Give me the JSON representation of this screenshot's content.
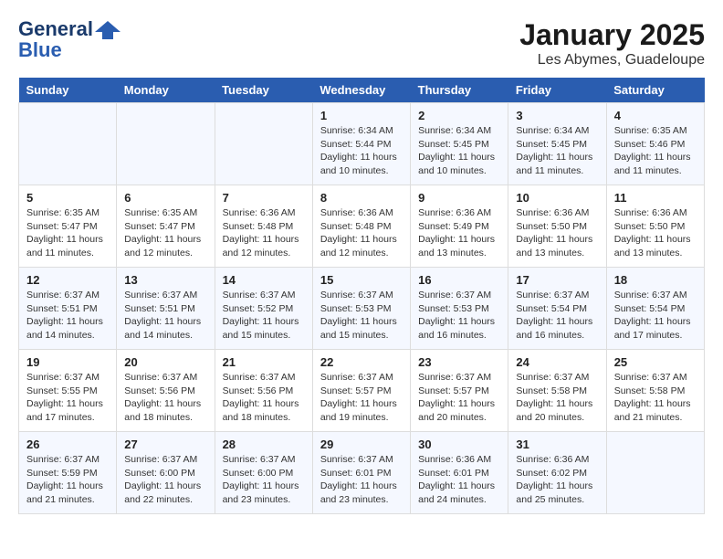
{
  "header": {
    "logo_line1": "General",
    "logo_line2": "Blue",
    "month_year": "January 2025",
    "location": "Les Abymes, Guadeloupe"
  },
  "weekdays": [
    "Sunday",
    "Monday",
    "Tuesday",
    "Wednesday",
    "Thursday",
    "Friday",
    "Saturday"
  ],
  "weeks": [
    [
      {
        "day": "",
        "info": ""
      },
      {
        "day": "",
        "info": ""
      },
      {
        "day": "",
        "info": ""
      },
      {
        "day": "1",
        "info": "Sunrise: 6:34 AM\nSunset: 5:44 PM\nDaylight: 11 hours\nand 10 minutes."
      },
      {
        "day": "2",
        "info": "Sunrise: 6:34 AM\nSunset: 5:45 PM\nDaylight: 11 hours\nand 10 minutes."
      },
      {
        "day": "3",
        "info": "Sunrise: 6:34 AM\nSunset: 5:45 PM\nDaylight: 11 hours\nand 11 minutes."
      },
      {
        "day": "4",
        "info": "Sunrise: 6:35 AM\nSunset: 5:46 PM\nDaylight: 11 hours\nand 11 minutes."
      }
    ],
    [
      {
        "day": "5",
        "info": "Sunrise: 6:35 AM\nSunset: 5:47 PM\nDaylight: 11 hours\nand 11 minutes."
      },
      {
        "day": "6",
        "info": "Sunrise: 6:35 AM\nSunset: 5:47 PM\nDaylight: 11 hours\nand 12 minutes."
      },
      {
        "day": "7",
        "info": "Sunrise: 6:36 AM\nSunset: 5:48 PM\nDaylight: 11 hours\nand 12 minutes."
      },
      {
        "day": "8",
        "info": "Sunrise: 6:36 AM\nSunset: 5:48 PM\nDaylight: 11 hours\nand 12 minutes."
      },
      {
        "day": "9",
        "info": "Sunrise: 6:36 AM\nSunset: 5:49 PM\nDaylight: 11 hours\nand 13 minutes."
      },
      {
        "day": "10",
        "info": "Sunrise: 6:36 AM\nSunset: 5:50 PM\nDaylight: 11 hours\nand 13 minutes."
      },
      {
        "day": "11",
        "info": "Sunrise: 6:36 AM\nSunset: 5:50 PM\nDaylight: 11 hours\nand 13 minutes."
      }
    ],
    [
      {
        "day": "12",
        "info": "Sunrise: 6:37 AM\nSunset: 5:51 PM\nDaylight: 11 hours\nand 14 minutes."
      },
      {
        "day": "13",
        "info": "Sunrise: 6:37 AM\nSunset: 5:51 PM\nDaylight: 11 hours\nand 14 minutes."
      },
      {
        "day": "14",
        "info": "Sunrise: 6:37 AM\nSunset: 5:52 PM\nDaylight: 11 hours\nand 15 minutes."
      },
      {
        "day": "15",
        "info": "Sunrise: 6:37 AM\nSunset: 5:53 PM\nDaylight: 11 hours\nand 15 minutes."
      },
      {
        "day": "16",
        "info": "Sunrise: 6:37 AM\nSunset: 5:53 PM\nDaylight: 11 hours\nand 16 minutes."
      },
      {
        "day": "17",
        "info": "Sunrise: 6:37 AM\nSunset: 5:54 PM\nDaylight: 11 hours\nand 16 minutes."
      },
      {
        "day": "18",
        "info": "Sunrise: 6:37 AM\nSunset: 5:54 PM\nDaylight: 11 hours\nand 17 minutes."
      }
    ],
    [
      {
        "day": "19",
        "info": "Sunrise: 6:37 AM\nSunset: 5:55 PM\nDaylight: 11 hours\nand 17 minutes."
      },
      {
        "day": "20",
        "info": "Sunrise: 6:37 AM\nSunset: 5:56 PM\nDaylight: 11 hours\nand 18 minutes."
      },
      {
        "day": "21",
        "info": "Sunrise: 6:37 AM\nSunset: 5:56 PM\nDaylight: 11 hours\nand 18 minutes."
      },
      {
        "day": "22",
        "info": "Sunrise: 6:37 AM\nSunset: 5:57 PM\nDaylight: 11 hours\nand 19 minutes."
      },
      {
        "day": "23",
        "info": "Sunrise: 6:37 AM\nSunset: 5:57 PM\nDaylight: 11 hours\nand 20 minutes."
      },
      {
        "day": "24",
        "info": "Sunrise: 6:37 AM\nSunset: 5:58 PM\nDaylight: 11 hours\nand 20 minutes."
      },
      {
        "day": "25",
        "info": "Sunrise: 6:37 AM\nSunset: 5:58 PM\nDaylight: 11 hours\nand 21 minutes."
      }
    ],
    [
      {
        "day": "26",
        "info": "Sunrise: 6:37 AM\nSunset: 5:59 PM\nDaylight: 11 hours\nand 21 minutes."
      },
      {
        "day": "27",
        "info": "Sunrise: 6:37 AM\nSunset: 6:00 PM\nDaylight: 11 hours\nand 22 minutes."
      },
      {
        "day": "28",
        "info": "Sunrise: 6:37 AM\nSunset: 6:00 PM\nDaylight: 11 hours\nand 23 minutes."
      },
      {
        "day": "29",
        "info": "Sunrise: 6:37 AM\nSunset: 6:01 PM\nDaylight: 11 hours\nand 23 minutes."
      },
      {
        "day": "30",
        "info": "Sunrise: 6:36 AM\nSunset: 6:01 PM\nDaylight: 11 hours\nand 24 minutes."
      },
      {
        "day": "31",
        "info": "Sunrise: 6:36 AM\nSunset: 6:02 PM\nDaylight: 11 hours\nand 25 minutes."
      },
      {
        "day": "",
        "info": ""
      }
    ]
  ]
}
